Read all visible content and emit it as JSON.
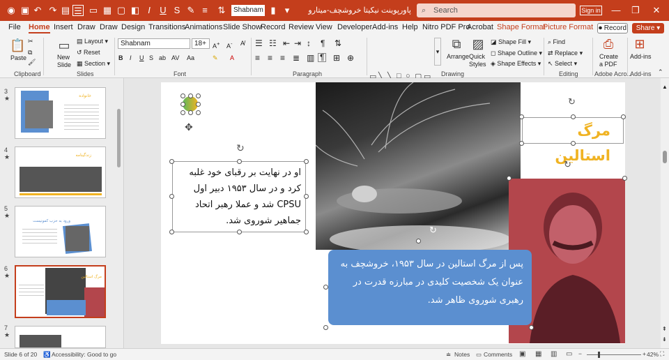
{
  "titlebar": {
    "font_name": "Shabnam",
    "doc_title": "پاورپوینت نیکیتا خروشچف-میتارو  -  Powe...",
    "search_placeholder": "Search",
    "signin_label": "Sign in",
    "quick_icons": [
      "autosave-icon",
      "save-icon",
      "undo-icon",
      "redo-icon",
      "present-icon",
      "layout-icon",
      "slide-icon",
      "picture-icon",
      "textbox-icon",
      "shapes-icon",
      "italic-icon",
      "underline-icon",
      "strike-icon",
      "more-icon"
    ]
  },
  "tabs": {
    "file": "File",
    "home": "Home",
    "insert": "Insert",
    "draw1": "Draw",
    "draw2": "Draw",
    "design": "Design",
    "transitions": "Transitions",
    "animations": "Animations",
    "slideshow": "Slide Show",
    "record": "Record",
    "review": "Review",
    "view": "View",
    "developer": "Developer",
    "addins": "Add-ins",
    "help": "Help",
    "nitro": "Nitro PDF Pro",
    "acrobat": "Acrobat",
    "shape_format": "Shape Format",
    "picture_format": "Picture Format",
    "record_btn": "Record",
    "share_btn": "Share"
  },
  "ribbon": {
    "paste": "Paste",
    "new_slide": "New Slide",
    "layout": "Layout",
    "reset": "Reset",
    "section": "Section",
    "font_family": "Shabnam",
    "font_size": "18+",
    "arrange": "Arrange",
    "quick_styles": "Quick Styles",
    "shape_fill": "Shape Fill",
    "shape_outline": "Shape Outline",
    "shape_effects": "Shape Effects",
    "find": "Find",
    "replace": "Replace",
    "select": "Select",
    "create_pdf": "Create a PDF",
    "addins": "Add-ins",
    "groups": {
      "clipboard": "Clipboard",
      "slides": "Slides",
      "font": "Font",
      "paragraph": "Paragraph",
      "drawing": "Drawing",
      "editing": "Editing",
      "adobe": "Adobe Acro...",
      "addins": "Add-ins"
    }
  },
  "thumbnails": [
    {
      "num": "3",
      "title": "خانواده"
    },
    {
      "num": "4",
      "title": "زندگینامه"
    },
    {
      "num": "5",
      "title": "ورود به حزب کمونیست"
    },
    {
      "num": "6",
      "title": "مرگ استالین"
    },
    {
      "num": "7",
      "title": ""
    }
  ],
  "slide": {
    "title": "مرگ استالین",
    "left_text": "او در نهایت بر رقبای خود غلبه کرد و در سال ۱۹۵۳ دبیر اول CPSU شد و عملا رهبر اتحاد جماهیر شوروی شد.",
    "blue_text": "پس از مرگ استالین در سال ۱۹۵۳، خروشچف به عنوان یک شخصیت کلیدی در مبارزه قدرت در رهبری شوروی ظاهر شد.",
    "colors": {
      "title": "#f0b323",
      "blue_box": "#5b8fd0",
      "red_photo": "#b3464c",
      "accent": "#c43e1c"
    }
  },
  "status": {
    "slide_of": "Slide 6 of 20",
    "accessibility": "Accessibility: Good to go",
    "notes": "Notes",
    "comments": "Comments",
    "zoom": "42%"
  }
}
